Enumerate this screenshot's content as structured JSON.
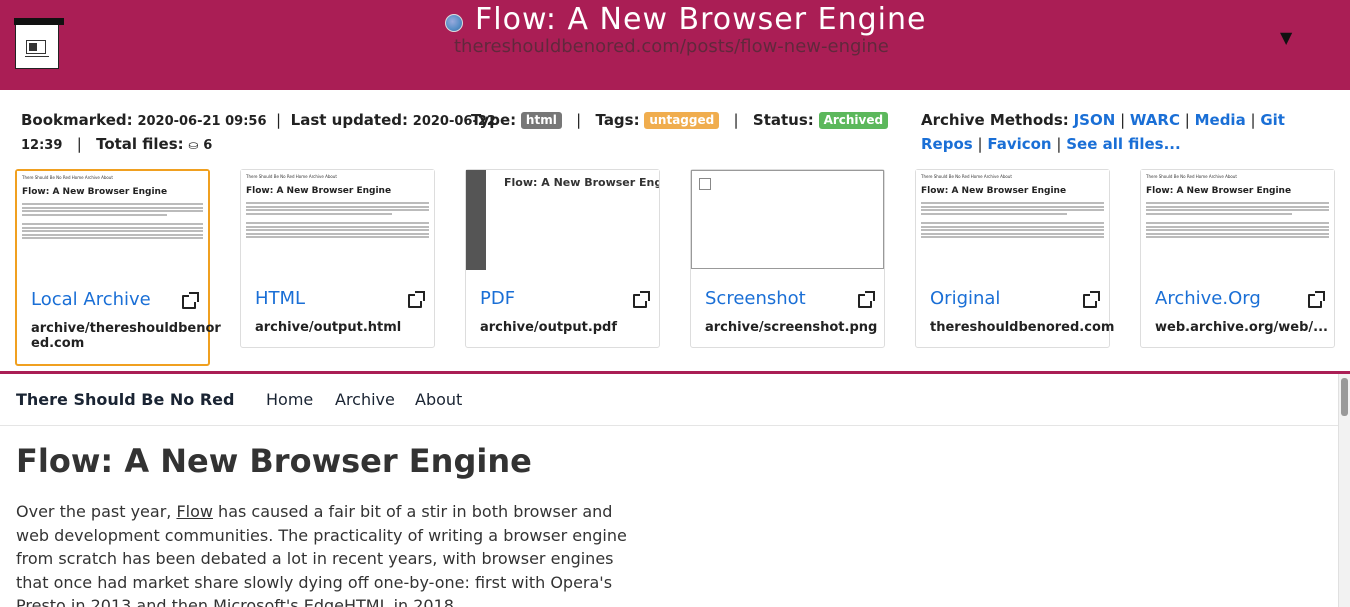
{
  "header": {
    "title": "Flow: A New Browser Engine",
    "url": "thereshouldbenored.com/posts/flow-new-engine",
    "menu_caret": "▼",
    "brand_color": "#aa1e55"
  },
  "meta": {
    "bookmarked_label": "Bookmarked:",
    "bookmarked_value_1": "2020-06-21 09:56",
    "sep": "|",
    "updated_label": "Last updated:",
    "updated_value_line1": "2020-06-22",
    "updated_value_line2": "12:39",
    "total_files_label": "Total files:",
    "total_files_icon": "⛀",
    "total_files_value": "6",
    "type_label": "Type:",
    "type_value": "html",
    "tags_label": "Tags:",
    "tags_value": "untagged",
    "status_label": "Status:",
    "status_value": "Archived",
    "methods_label": "Archive Methods:",
    "methods": [
      "JSON",
      "WARC",
      "Media",
      "Git Repos",
      "Favicon",
      "See all files..."
    ]
  },
  "cards": [
    {
      "name": "Local Archive",
      "path_line1": "archive/thereshouldbenor",
      "path_line2": "ed.com"
    },
    {
      "name": "HTML",
      "path_line1": "archive/output.html",
      "path_line2": ""
    },
    {
      "name": "PDF",
      "path_line1": "archive/output.pdf",
      "path_line2": ""
    },
    {
      "name": "Screenshot",
      "path_line1": "archive/screenshot.png",
      "path_line2": ""
    },
    {
      "name": "Original",
      "path_line1": "thereshouldbenored.com",
      "path_line2": ""
    },
    {
      "name": "Archive.Org",
      "path_line1": "web.archive.org/web/...",
      "path_line2": ""
    }
  ],
  "thumb": {
    "nav_text": "There Should Be No Red     Home   Archive   About",
    "title": "Flow: A New Browser Engine"
  },
  "page": {
    "site_name": "There Should Be No Red",
    "nav": [
      "Home",
      "Archive",
      "About"
    ],
    "h1": "Flow: A New Browser Engine",
    "p_before": "Over the past year, ",
    "p_link": "Flow",
    "p_after": " has caused a fair bit of a stir in both browser and web development communities. The practicality of writing a browser engine from scratch has been debated a lot in recent years, with browser engines that once had market share slowly dying off one-by-one: first with Opera's Presto in 2013 and then Microsoft's EdgeHTML in 2018."
  }
}
